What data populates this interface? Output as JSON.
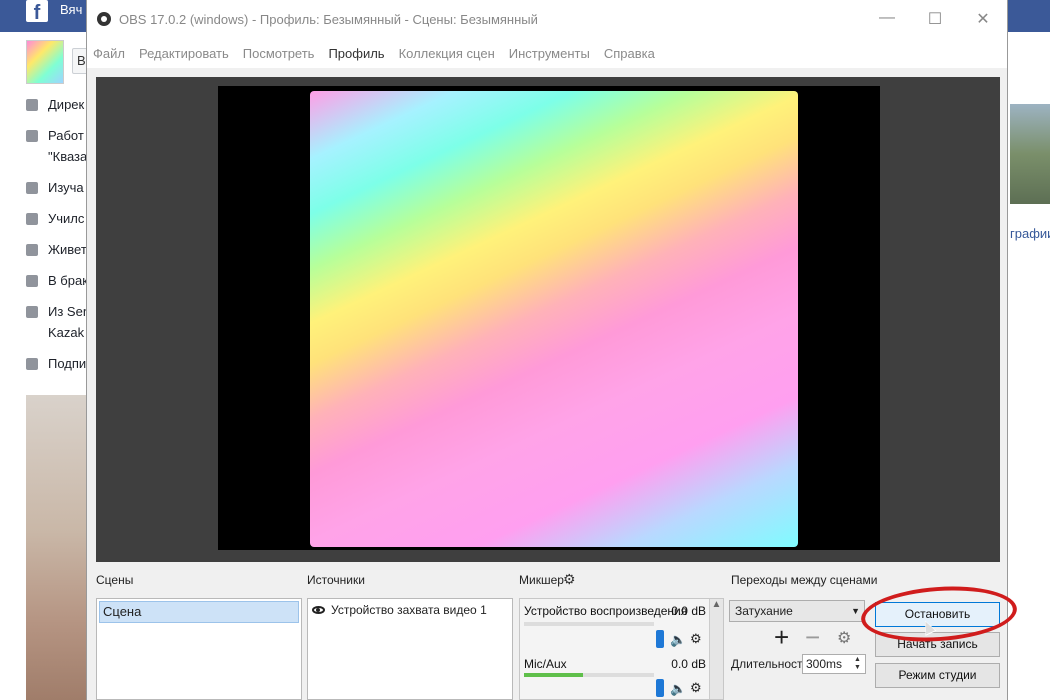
{
  "facebook": {
    "top_name": "Вяч",
    "profile_chip": "В",
    "info_rows": [
      {
        "text": "Дирек"
      },
      {
        "text": "Работ"
      },
      {
        "text": "\"Кваза"
      },
      {
        "text": "Изуча"
      },
      {
        "text": "Училс"
      },
      {
        "text": "Живет"
      },
      {
        "text": "В брак"
      },
      {
        "text": "Из Sen"
      },
      {
        "text": "Kazak"
      },
      {
        "text": "Подпи"
      }
    ],
    "right_text": "графии,"
  },
  "window": {
    "title": "OBS 17.0.2 (windows) - Профиль: Безымянный - Сцены: Безымянный",
    "minimize": "—",
    "maximize": "☐",
    "close": "✕"
  },
  "menu": [
    "Файл",
    "Редактировать",
    "Посмотреть",
    "Профиль",
    "Коллекция сцен",
    "Инструменты",
    "Справка"
  ],
  "docks": {
    "scenes_title": "Сцены",
    "sources_title": "Источники",
    "mixer_title": "Микшер",
    "transitions_title": "Переходы между сценами"
  },
  "scenes": [
    "Сцена"
  ],
  "sources": [
    "Устройство захвата видео 1"
  ],
  "mixer": [
    {
      "name": "Устройство воспроизведения",
      "db": "0.0 dB",
      "level": 0.0
    },
    {
      "name": "Mic/Aux",
      "db": "0.0 dB",
      "level": 0.45
    }
  ],
  "transitions": {
    "selected": "Затухание",
    "duration_label": "Длительность",
    "duration_value": "300ms"
  },
  "controls": {
    "stop_stream": "Остановить трансляцию",
    "start_record": "Начать запись",
    "studio_mode": "Режим студии"
  },
  "colors": {
    "highlight_ring": "#d01c1c",
    "selection": "#cde2f7",
    "slider": "#1e78d6"
  }
}
